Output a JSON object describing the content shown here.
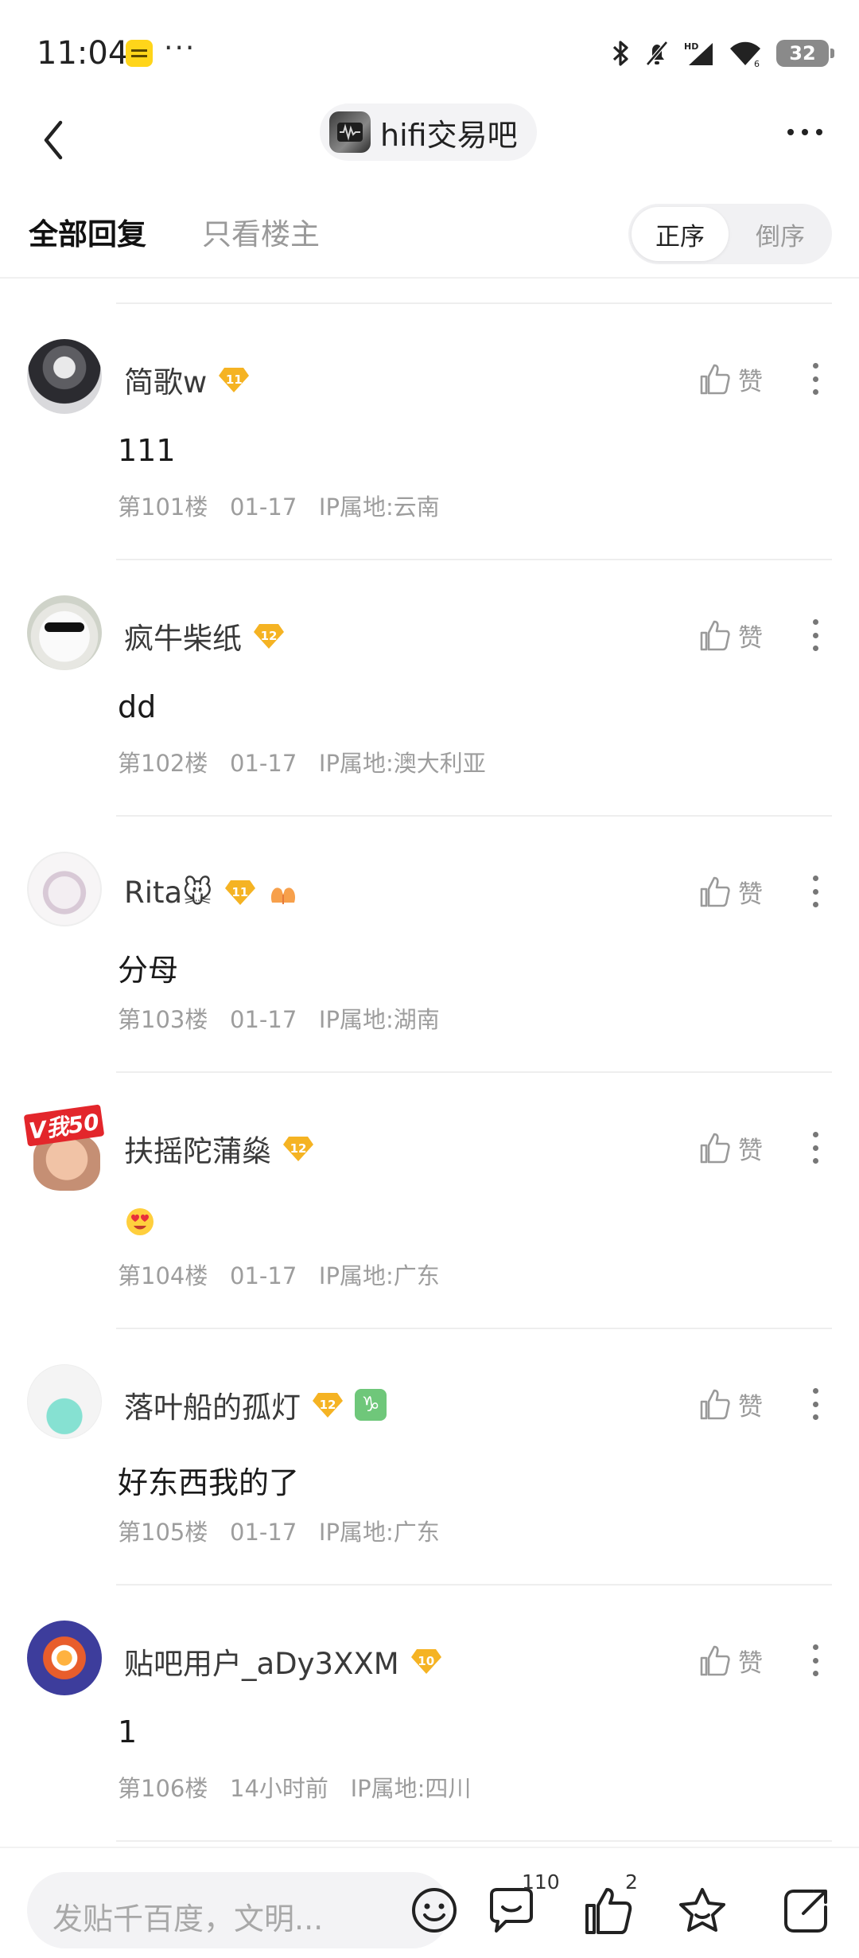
{
  "status_bar": {
    "time": "11:04",
    "more": "···",
    "battery": "32"
  },
  "header": {
    "forum_name": "hifi交易吧"
  },
  "tabs": {
    "all_replies": "全部回复",
    "only_op": "只看楼主"
  },
  "sort": {
    "ascending": "正序",
    "descending": "倒序"
  },
  "like_label": "赞",
  "replies": [
    {
      "username": "简歌w",
      "level": "11",
      "content": "111",
      "meta": "第101楼   01-17   IP属地:云南"
    },
    {
      "username": "疯牛柴纸",
      "level": "12",
      "content": "dd",
      "meta": "第102楼   01-17   IP属地:澳大利亚"
    },
    {
      "username": "Rita🐭",
      "level": "11",
      "content": "分母",
      "meta": "第103楼   01-17   IP属地:湖南"
    },
    {
      "username": "扶摇陀蒲燊",
      "level": "12",
      "content": "",
      "meta": "第104楼   01-17   IP属地:广东",
      "avatar_badge": "V我50"
    },
    {
      "username": "落叶船的孤灯",
      "level": "12",
      "content": "好东西我的了",
      "meta": "第105楼   01-17   IP属地:广东",
      "zodiac": "♑"
    },
    {
      "username": "贴吧用户_aDy3XXM",
      "level": "10",
      "content": "1",
      "meta": "第106楼   14小时前   IP属地:四川"
    }
  ],
  "bottom_bar": {
    "input_placeholder": "发贴千百度，文明...",
    "comment_count": "110",
    "like_count": "2"
  },
  "colors": {
    "level_badge": "#f5b323",
    "divider": "#eeeeee",
    "meta_text": "#9d9d9d"
  }
}
